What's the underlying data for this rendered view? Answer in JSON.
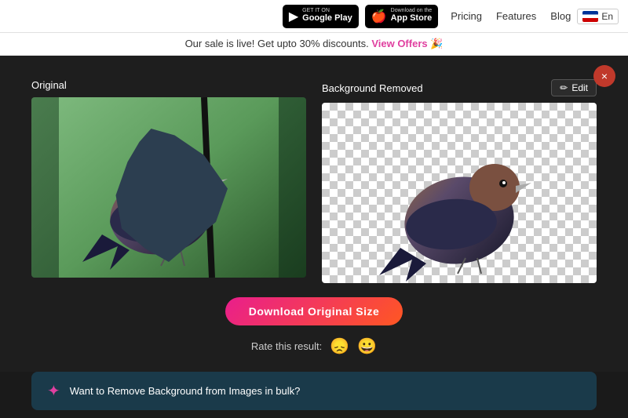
{
  "nav": {
    "google_play_small": "GET IT ON",
    "google_play_main": "Google Play",
    "app_store_small": "Download on the",
    "app_store_main": "App Store",
    "links": [
      {
        "label": "Pricing",
        "id": "pricing"
      },
      {
        "label": "Features",
        "id": "features"
      },
      {
        "label": "Blog",
        "id": "blog"
      }
    ],
    "lang": "En"
  },
  "sale_banner": {
    "text": "Our sale is live! Get upto 30% discounts.",
    "cta": "View Offers",
    "emoji": "🎉"
  },
  "main": {
    "original_label": "Original",
    "removed_label": "Background Removed",
    "edit_label": "Edit",
    "download_btn": "Download Original Size",
    "rate_label": "Rate this result:"
  },
  "promo": {
    "text": "Want to Remove Background from Images in bulk?",
    "icon": "✦"
  },
  "close_icon": "×",
  "sad_emoji": "😞",
  "happy_emoji": "😀"
}
